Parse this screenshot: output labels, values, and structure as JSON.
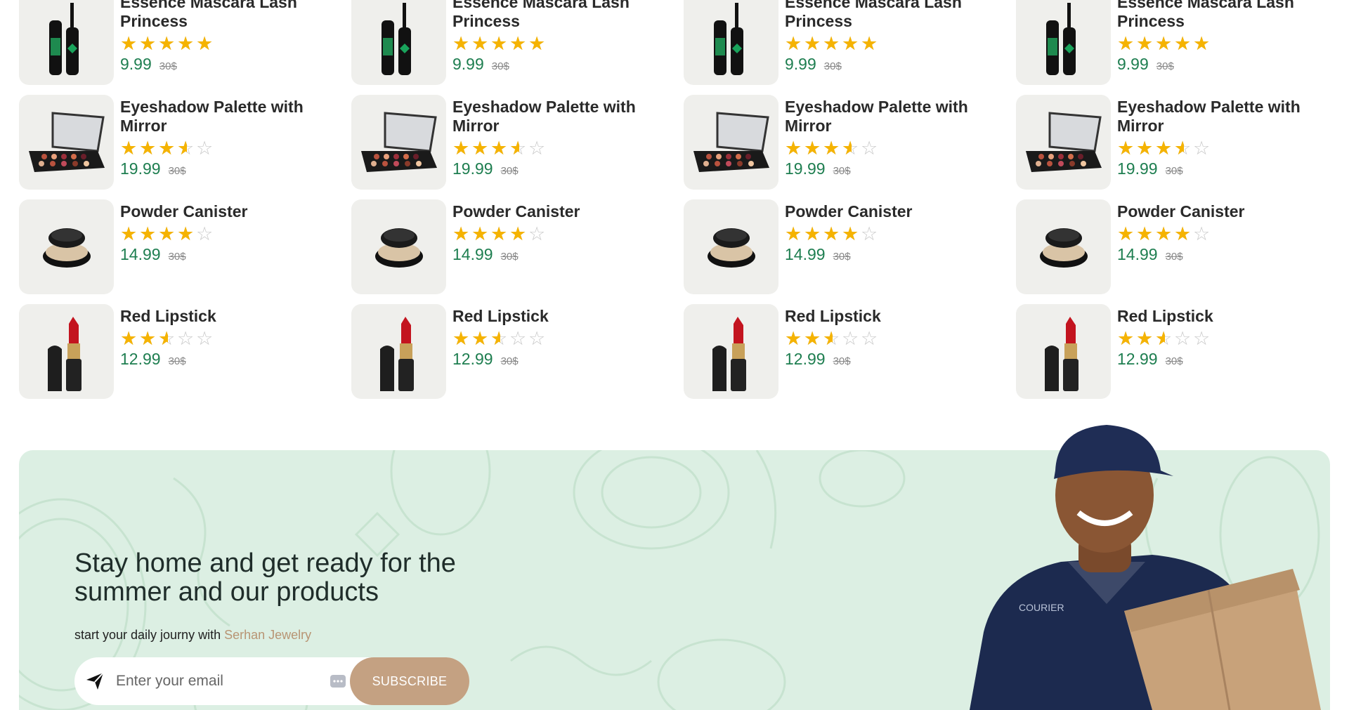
{
  "products": [
    {
      "title": "Essence Mascara Lash Princess",
      "price": "9.99",
      "old_price": "30$",
      "rating": 5,
      "image": "mascara"
    },
    {
      "title": "Essence Mascara Lash Princess",
      "price": "9.99",
      "old_price": "30$",
      "rating": 5,
      "image": "mascara"
    },
    {
      "title": "Essence Mascara Lash Princess",
      "price": "9.99",
      "old_price": "30$",
      "rating": 5,
      "image": "mascara"
    },
    {
      "title": "Essence Mascara Lash Princess",
      "price": "9.99",
      "old_price": "30$",
      "rating": 5,
      "image": "mascara"
    },
    {
      "title": "Eyeshadow Palette with Mirror",
      "price": "19.99",
      "old_price": "30$",
      "rating": 3.5,
      "image": "palette"
    },
    {
      "title": "Eyeshadow Palette with Mirror",
      "price": "19.99",
      "old_price": "30$",
      "rating": 3.5,
      "image": "palette"
    },
    {
      "title": "Eyeshadow Palette with Mirror",
      "price": "19.99",
      "old_price": "30$",
      "rating": 3.5,
      "image": "palette"
    },
    {
      "title": "Eyeshadow Palette with Mirror",
      "price": "19.99",
      "old_price": "30$",
      "rating": 3.5,
      "image": "palette"
    },
    {
      "title": "Powder Canister",
      "price": "14.99",
      "old_price": "30$",
      "rating": 4,
      "image": "powder"
    },
    {
      "title": "Powder Canister",
      "price": "14.99",
      "old_price": "30$",
      "rating": 4,
      "image": "powder"
    },
    {
      "title": "Powder Canister",
      "price": "14.99",
      "old_price": "30$",
      "rating": 4,
      "image": "powder"
    },
    {
      "title": "Powder Canister",
      "price": "14.99",
      "old_price": "30$",
      "rating": 4,
      "image": "powder"
    },
    {
      "title": "Red Lipstick",
      "price": "12.99",
      "old_price": "30$",
      "rating": 2.5,
      "image": "lipstick"
    },
    {
      "title": "Red Lipstick",
      "price": "12.99",
      "old_price": "30$",
      "rating": 2.5,
      "image": "lipstick"
    },
    {
      "title": "Red Lipstick",
      "price": "12.99",
      "old_price": "30$",
      "rating": 2.5,
      "image": "lipstick"
    },
    {
      "title": "Red Lipstick",
      "price": "12.99",
      "old_price": "30$",
      "rating": 2.5,
      "image": "lipstick"
    }
  ],
  "banner": {
    "headline": "Stay home and get ready for the summer and our products",
    "sub_prefix": "start your daily journy with ",
    "brand": "Serhan Jewelry",
    "email_placeholder": "Enter your email",
    "subscribe_label": "SUBSCRIBE"
  },
  "colors": {
    "star": "#f5b301",
    "price": "#1e7e50",
    "banner_bg": "#dcefe3",
    "subscribe_bg": "#c4a182",
    "brand_text": "#b89473"
  },
  "icons": {
    "send": "send-icon",
    "email_field_extra": "more-dots-icon"
  }
}
